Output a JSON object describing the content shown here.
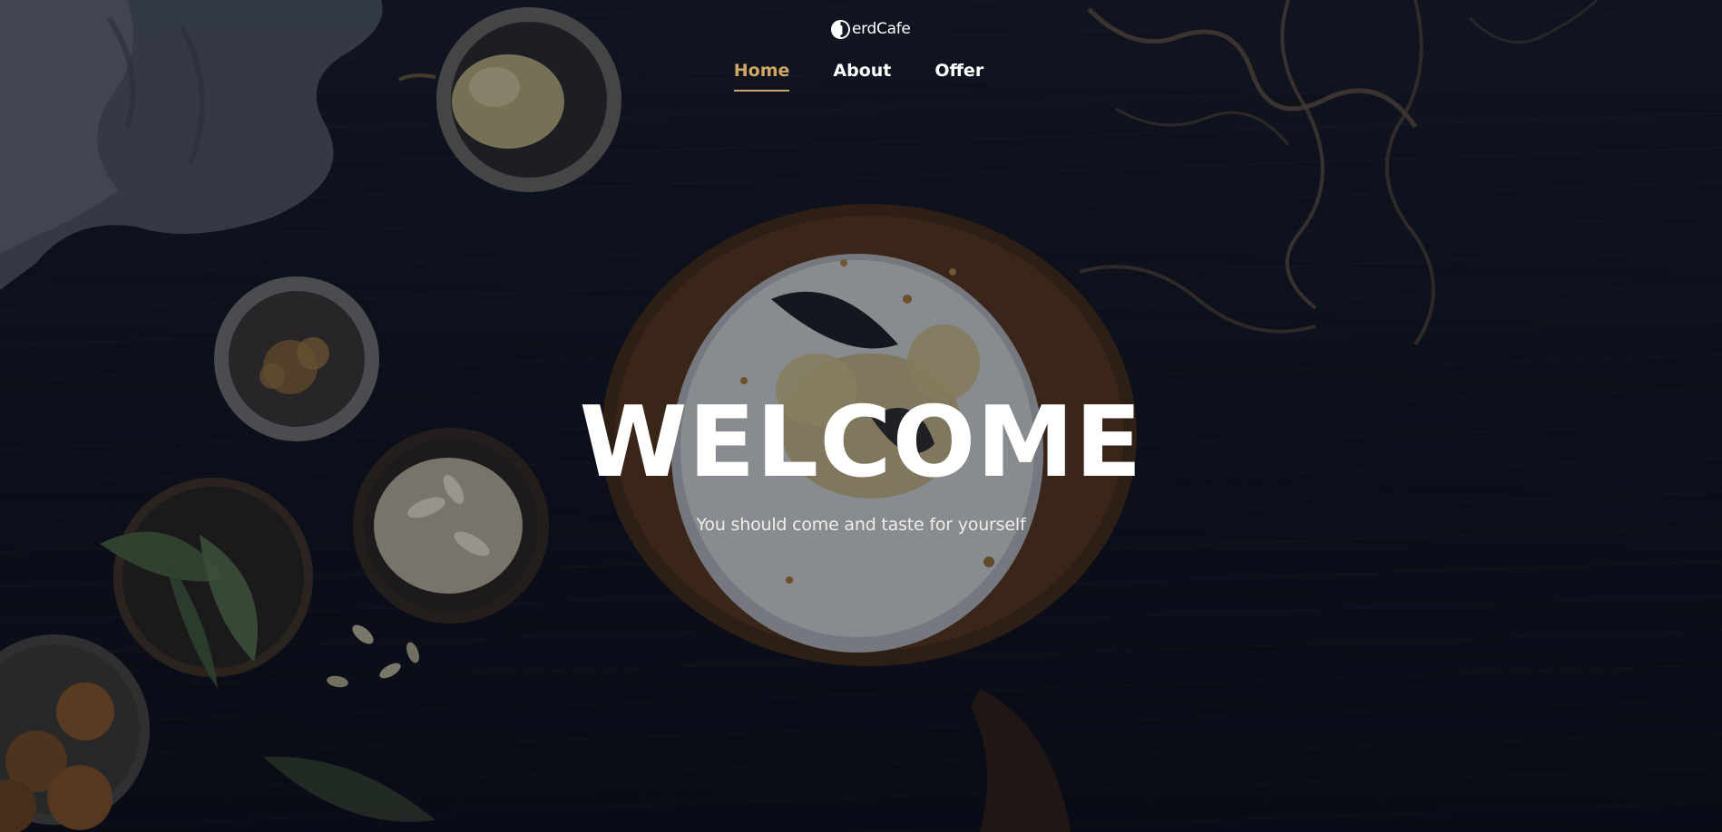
{
  "brand": {
    "name": "erdCafe",
    "accent_color": "#d1a566",
    "logo_icon": "half-moon-logo-icon"
  },
  "nav": {
    "items": [
      {
        "label": "Home",
        "active": true
      },
      {
        "label": "About",
        "active": false
      },
      {
        "label": "Offer",
        "active": false
      }
    ]
  },
  "hero": {
    "title": "WELCOME",
    "subtitle": "You should come and taste for yourself"
  }
}
